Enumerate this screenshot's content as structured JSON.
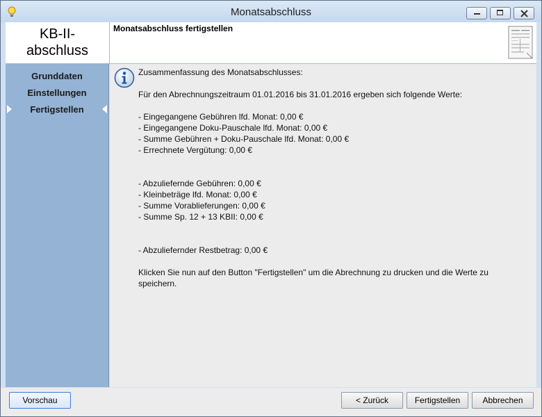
{
  "window": {
    "title": "Monatsabschluss"
  },
  "header": {
    "left_title_line1": "KB-II-",
    "left_title_line2": "abschluss",
    "step_title": "Monatsabschluss fertigstellen"
  },
  "nav": {
    "items": [
      {
        "label": "Grunddaten",
        "active": false
      },
      {
        "label": "Einstellungen",
        "active": false
      },
      {
        "label": "Fertigstellen",
        "active": true
      }
    ]
  },
  "content": {
    "heading": "Zusammenfassung des Monatsabschlusses:",
    "period_text": "Für den Abrechnungszeitraum 01.01.2016 bis 31.01.2016 ergeben sich folgende Werte:",
    "group1": [
      "- Eingegangene Gebühren lfd. Monat: 0,00 €",
      "- Eingegangene Doku-Pauschale lfd. Monat: 0,00 €",
      "- Summe Gebühren + Doku-Pauschale lfd. Monat: 0,00 €",
      "- Errechnete Vergütung: 0,00 €"
    ],
    "group2": [
      "- Abzuliefernde Gebühren: 0,00 €",
      "- Kleinbeträge lfd. Monat: 0,00 €",
      "- Summe Vorablieferungen: 0,00 €",
      "- Summe Sp. 12 + 13 KBII: 0,00 €"
    ],
    "group3": [
      "- Abzuliefernder Restbetrag: 0,00 €"
    ],
    "instruction": "Klicken Sie nun auf den Button \"Fertigstellen\" um die Abrechnung zu drucken und die Werte zu speichern."
  },
  "footer": {
    "preview_label": "Vorschau",
    "back_label": "< Zurück",
    "finish_label": "Fertigstellen",
    "cancel_label": "Abbrechen"
  },
  "colors": {
    "nav_bg": "#95b3d4",
    "content_bg": "#ececec",
    "frame_bg": "#cfe0f1"
  }
}
